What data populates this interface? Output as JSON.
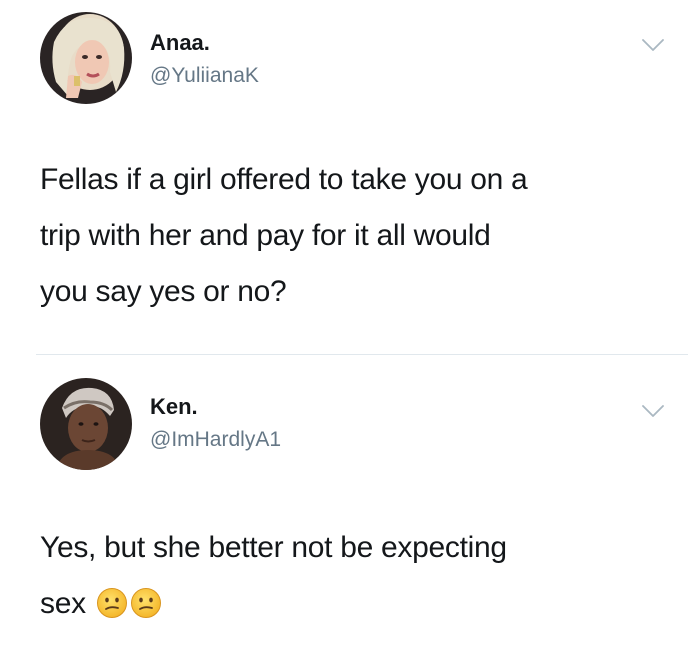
{
  "tweets": [
    {
      "display_name": "Anaa.",
      "handle": "@YuliianaK",
      "text_lines": [
        "Fellas if a girl offered to take you on a",
        "trip with her and pay for it all would",
        "you say yes or no?"
      ],
      "menu_icon": "chevron-down-icon"
    },
    {
      "display_name": "Ken.",
      "handle": "@ImHardlyA1",
      "text_lines": [
        "Yes, but she better not be expecting",
        "sex"
      ],
      "emojis": [
        "confused-face-emoji",
        "confused-face-emoji"
      ],
      "menu_icon": "chevron-down-icon"
    }
  ],
  "colors": {
    "name": "#14171a",
    "handle": "#657786",
    "divider": "#e1e8ed",
    "chevron": "#aab8c2",
    "emoji": "#f7c52d"
  }
}
